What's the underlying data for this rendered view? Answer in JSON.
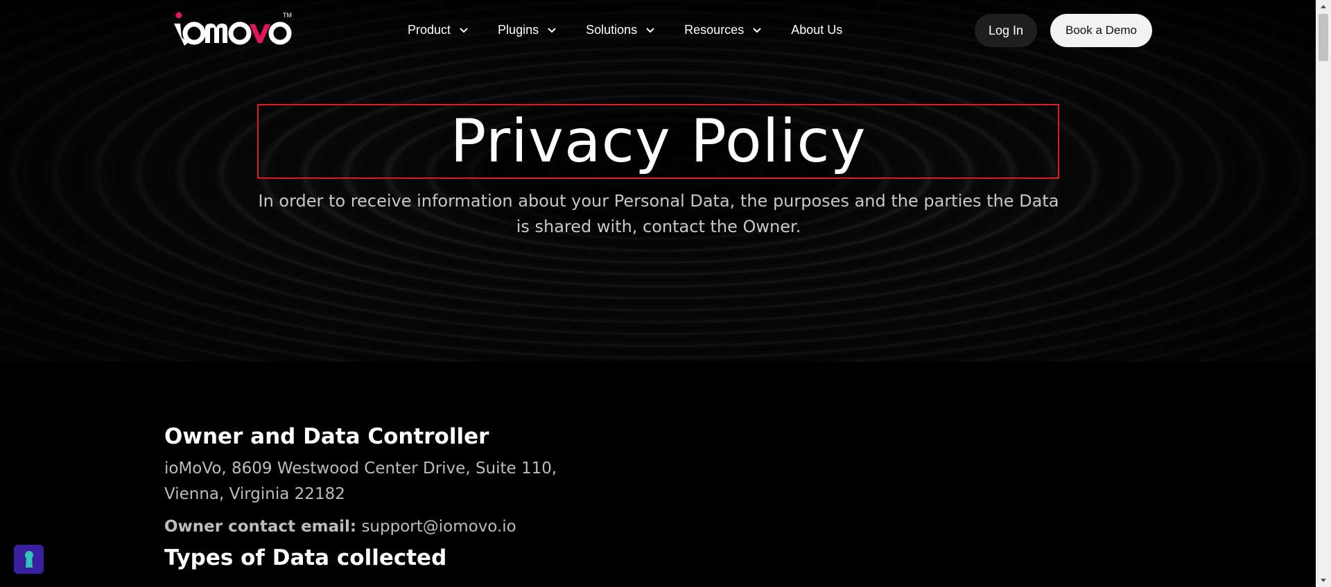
{
  "header": {
    "logo_text": "iomovo",
    "logo_tm": "TM",
    "nav": [
      {
        "label": "Product",
        "has_dropdown": true
      },
      {
        "label": "Plugins",
        "has_dropdown": true
      },
      {
        "label": "Solutions",
        "has_dropdown": true
      },
      {
        "label": "Resources",
        "has_dropdown": true
      },
      {
        "label": "About Us",
        "has_dropdown": false
      }
    ],
    "login_label": "Log In",
    "demo_label": "Book a Demo"
  },
  "hero": {
    "title": "Privacy Policy",
    "subtitle": "In order to receive information about your Personal Data, the purposes and the parties the Data is shared with, contact the Owner."
  },
  "content": {
    "owner_heading": "Owner and Data Controller",
    "owner_address": "ioMoVo, 8609 Westwood Center Drive, Suite 110, Vienna, Virginia 22182",
    "contact_label": "Owner contact email:",
    "contact_email": "support@iomovo.io",
    "types_heading": "Types of Data collected"
  },
  "colors": {
    "accent_red": "#e11b1b",
    "brand_pink": "#e3165b",
    "privacy_button": "#3a1f9e",
    "privacy_icon": "#2ec4b6"
  },
  "icons": {
    "nav_chevron": "chevron-down-icon",
    "privacy_widget": "keyhole-icon"
  }
}
